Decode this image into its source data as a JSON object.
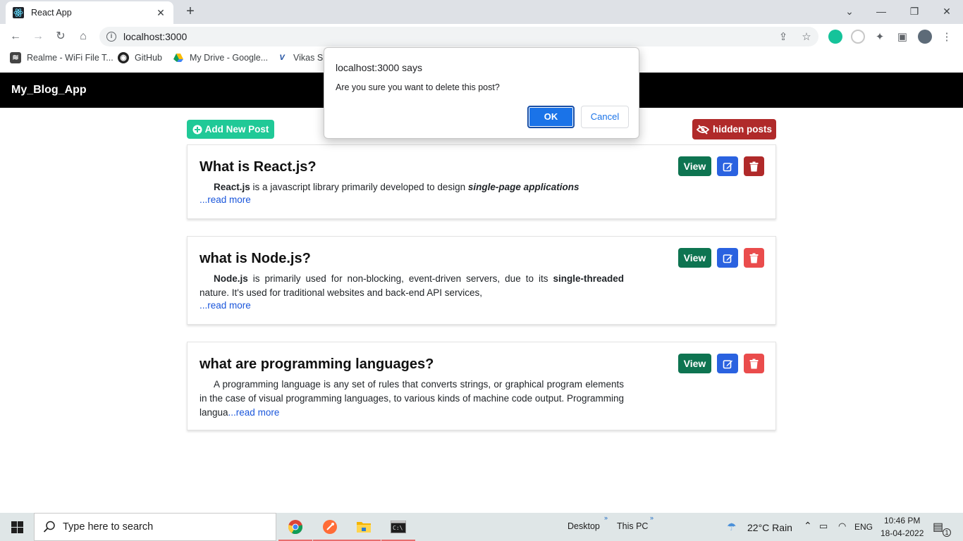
{
  "browser": {
    "tab_title": "React App",
    "url": "localhost:3000",
    "bookmarks": [
      "Realme - WiFi File T...",
      "GitHub",
      "My Drive - Google...",
      "Vikas Sh"
    ]
  },
  "dialog": {
    "title": "localhost:3000 says",
    "message": "Are you sure you want to delete this post?",
    "ok_label": "OK",
    "cancel_label": "Cancel"
  },
  "app": {
    "brand": "My_Blog_App",
    "add_post_label": "Add New Post",
    "hidden_posts_label": "hidden posts",
    "view_label": "View",
    "read_more": "...read more",
    "posts": [
      {
        "title": "What is React.js?",
        "strong": "React.js",
        "text1": " is a javascript library primarily developed to design ",
        "emph": "single-page applications",
        "text2": ""
      },
      {
        "title": "what is Node.js?",
        "strong": "Node.js",
        "text1": " is primarily used for non-blocking, event-driven servers, due to its ",
        "emph": "single-threaded",
        "text2": " nature. It's used for traditional websites and back-end API services,"
      },
      {
        "title": "what are programming languages?",
        "text": "A programming language is any set of rules that converts strings, or graphical program elements in the case of visual programming languages, to various kinds of machine code output. Programming langua"
      }
    ]
  },
  "taskbar": {
    "search_placeholder": "Type here to search",
    "desktop_label": "Desktop",
    "thispc_label": "This PC",
    "weather": "22°C  Rain",
    "language": "ENG",
    "time": "10:46 PM",
    "date": "18-04-2022",
    "notif_count": "1"
  },
  "colors": {
    "add_button": "#20c997",
    "hidden_button": "#b02a2a",
    "view_button": "#0e7451",
    "edit_button": "#2a62e0",
    "delete_active": "#b02a2a",
    "delete_button": "#ea4c4c"
  }
}
